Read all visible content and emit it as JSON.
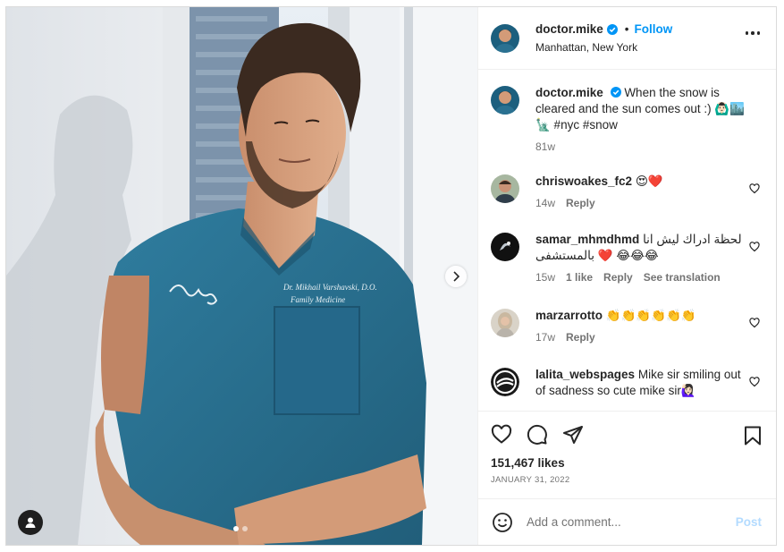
{
  "post": {
    "author": "doctor.mike",
    "follow_label": "Follow",
    "separator": "•",
    "location": "Manhattan, New York",
    "caption": "When the snow is cleared and the sun comes out :) 🙆🏻‍♂️🏙️🗽 #nyc #snow",
    "caption_time": "81w",
    "image_alt": "Man in teal medical scrubs leaning against a sunlit white wall by a window",
    "scrub_name": "Dr. Mikhail Varshavski, D.O.",
    "scrub_dept": "Family Medicine",
    "scrub_monogram": "Dm"
  },
  "comments": [
    {
      "user": "chriswoakes_fc2",
      "text": "😍❤️",
      "time": "14w",
      "likes": "",
      "actions": [
        "Reply"
      ]
    },
    {
      "user": "samar_mhmdhmd",
      "text": "لحظة ادراك ليش انا بالمستشفى ❤️ 😂😂😂",
      "time": "15w",
      "likes": "1 like",
      "actions": [
        "Reply",
        "See translation"
      ]
    },
    {
      "user": "marzarrotto",
      "text": "👏👏👏👏👏👏",
      "time": "17w",
      "likes": "",
      "actions": [
        "Reply"
      ]
    },
    {
      "user": "lalita_webspages",
      "text": "Mike sir smiling out of sadness so cute mike sir🙋🏻‍♀️",
      "time": "",
      "likes": "",
      "actions": []
    }
  ],
  "stats": {
    "likes": "151,467 likes",
    "date": "JANUARY 31, 2022"
  },
  "add_comment": {
    "placeholder": "Add a comment...",
    "post_label": "Post"
  },
  "colors": {
    "accent": "#0095f6",
    "post_disabled": "#b3dbff",
    "scrub": "#2a7191",
    "verified": "#0095f6",
    "text": "#262626",
    "muted": "#737373",
    "border": "#dbdbdb"
  },
  "icons": {
    "verified": "verified-badge-icon",
    "more": "more-options-icon",
    "like": "heart-outline-icon",
    "comment": "comment-bubble-icon",
    "share": "paper-plane-icon",
    "save": "bookmark-icon",
    "emoji": "emoji-smile-icon",
    "next": "chevron-right-icon",
    "tag": "user-tag-icon",
    "comment_like": "small-heart-icon"
  },
  "carousel": {
    "count": 2,
    "active": 1
  }
}
